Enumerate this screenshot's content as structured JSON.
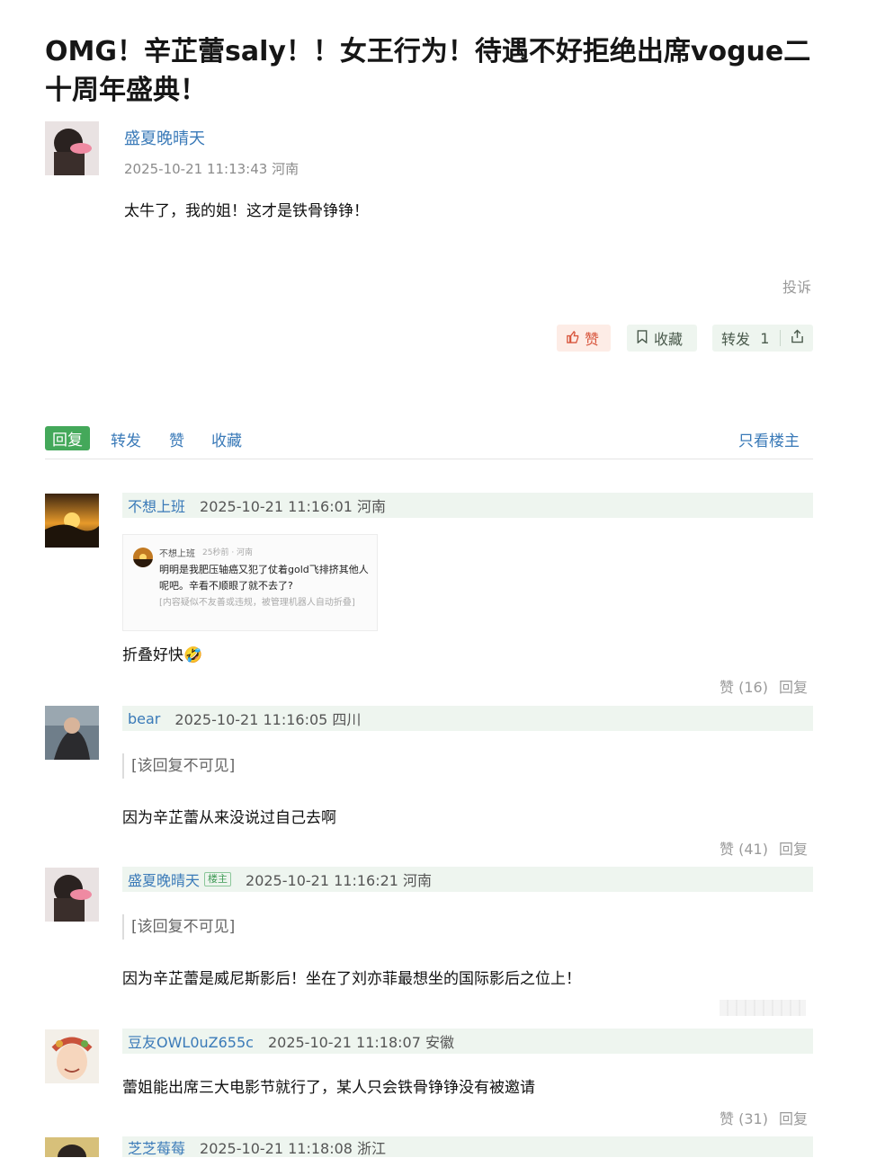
{
  "post": {
    "title": "OMG！辛芷蕾saly！！女王行为！待遇不好拒绝出席vogue二十周年盛典！",
    "author": "盛夏晚晴天",
    "meta": "2025-10-21 11:13:43 河南",
    "content": "太牛了，我的姐！这才是铁骨铮铮！",
    "report_label": "投诉",
    "like_label": "赞",
    "fav_label": "收藏",
    "share_label": "转发",
    "share_count": "1"
  },
  "tabs": {
    "reply": "回复",
    "repost": "转发",
    "like": "赞",
    "fav": "收藏",
    "op_only": "只看楼主"
  },
  "comments": [
    {
      "user": "不想上班",
      "time": "2025-10-21 11:16:01 河南",
      "snapshot": {
        "user": "不想上班",
        "meta": "25秒前 · 河南",
        "body": "明明是我肥压轴癌又犯了仗着gold飞排挤其他人呢吧。辛看不顺眼了就不去了?",
        "note": "[内容疑似不友善或违规，被管理机器人自动折叠]"
      },
      "text": "折叠好快🤣",
      "likes": "赞 (16)",
      "reply": "回复"
    },
    {
      "user": "bear",
      "time": "2025-10-21 11:16:05 四川",
      "quote": "[该回复不可见]",
      "text": "因为辛芷蕾从来没说过自己去啊",
      "likes": "赞 (41)",
      "reply": "回复"
    },
    {
      "user": "盛夏晚晴天",
      "badge": "楼主",
      "time": "2025-10-21 11:16:21 河南",
      "quote": "[该回复不可见]",
      "text": "因为辛芷蕾是威尼斯影后！坐在了刘亦菲最想坐的国际影后之位上！"
    },
    {
      "user": "豆友OWL0uZ655c",
      "time": "2025-10-21 11:18:07 安徽",
      "text": "蕾姐能出席三大电影节就行了，某人只会铁骨铮铮没有被邀请",
      "likes": "赞 (31)",
      "reply": "回复"
    },
    {
      "user": "芝芝莓莓",
      "time": "2025-10-21 11:18:08 浙江"
    }
  ],
  "colors": {
    "link": "#3a7ab8",
    "accent_green": "#44a85a",
    "header_bg": "#eef5ef",
    "like_bg": "#fdece6"
  },
  "icons": [
    "thumbs-up-icon",
    "bookmark-icon",
    "share-icon"
  ]
}
